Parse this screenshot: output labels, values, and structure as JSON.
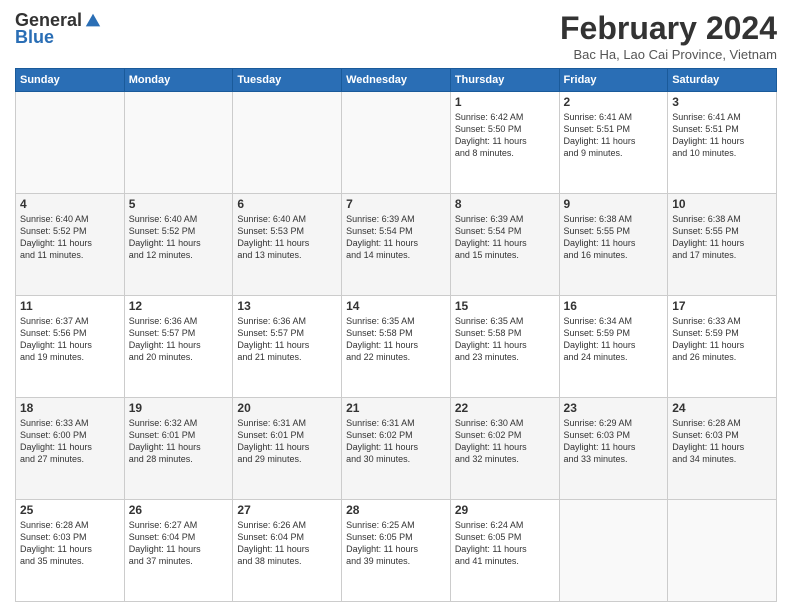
{
  "logo": {
    "general": "General",
    "blue": "Blue"
  },
  "header": {
    "month": "February 2024",
    "location": "Bac Ha, Lao Cai Province, Vietnam"
  },
  "days_of_week": [
    "Sunday",
    "Monday",
    "Tuesday",
    "Wednesday",
    "Thursday",
    "Friday",
    "Saturday"
  ],
  "weeks": [
    [
      {
        "day": "",
        "info": ""
      },
      {
        "day": "",
        "info": ""
      },
      {
        "day": "",
        "info": ""
      },
      {
        "day": "",
        "info": ""
      },
      {
        "day": "1",
        "info": "Sunrise: 6:42 AM\nSunset: 5:50 PM\nDaylight: 11 hours\nand 8 minutes."
      },
      {
        "day": "2",
        "info": "Sunrise: 6:41 AM\nSunset: 5:51 PM\nDaylight: 11 hours\nand 9 minutes."
      },
      {
        "day": "3",
        "info": "Sunrise: 6:41 AM\nSunset: 5:51 PM\nDaylight: 11 hours\nand 10 minutes."
      }
    ],
    [
      {
        "day": "4",
        "info": "Sunrise: 6:40 AM\nSunset: 5:52 PM\nDaylight: 11 hours\nand 11 minutes."
      },
      {
        "day": "5",
        "info": "Sunrise: 6:40 AM\nSunset: 5:52 PM\nDaylight: 11 hours\nand 12 minutes."
      },
      {
        "day": "6",
        "info": "Sunrise: 6:40 AM\nSunset: 5:53 PM\nDaylight: 11 hours\nand 13 minutes."
      },
      {
        "day": "7",
        "info": "Sunrise: 6:39 AM\nSunset: 5:54 PM\nDaylight: 11 hours\nand 14 minutes."
      },
      {
        "day": "8",
        "info": "Sunrise: 6:39 AM\nSunset: 5:54 PM\nDaylight: 11 hours\nand 15 minutes."
      },
      {
        "day": "9",
        "info": "Sunrise: 6:38 AM\nSunset: 5:55 PM\nDaylight: 11 hours\nand 16 minutes."
      },
      {
        "day": "10",
        "info": "Sunrise: 6:38 AM\nSunset: 5:55 PM\nDaylight: 11 hours\nand 17 minutes."
      }
    ],
    [
      {
        "day": "11",
        "info": "Sunrise: 6:37 AM\nSunset: 5:56 PM\nDaylight: 11 hours\nand 19 minutes."
      },
      {
        "day": "12",
        "info": "Sunrise: 6:36 AM\nSunset: 5:57 PM\nDaylight: 11 hours\nand 20 minutes."
      },
      {
        "day": "13",
        "info": "Sunrise: 6:36 AM\nSunset: 5:57 PM\nDaylight: 11 hours\nand 21 minutes."
      },
      {
        "day": "14",
        "info": "Sunrise: 6:35 AM\nSunset: 5:58 PM\nDaylight: 11 hours\nand 22 minutes."
      },
      {
        "day": "15",
        "info": "Sunrise: 6:35 AM\nSunset: 5:58 PM\nDaylight: 11 hours\nand 23 minutes."
      },
      {
        "day": "16",
        "info": "Sunrise: 6:34 AM\nSunset: 5:59 PM\nDaylight: 11 hours\nand 24 minutes."
      },
      {
        "day": "17",
        "info": "Sunrise: 6:33 AM\nSunset: 5:59 PM\nDaylight: 11 hours\nand 26 minutes."
      }
    ],
    [
      {
        "day": "18",
        "info": "Sunrise: 6:33 AM\nSunset: 6:00 PM\nDaylight: 11 hours\nand 27 minutes."
      },
      {
        "day": "19",
        "info": "Sunrise: 6:32 AM\nSunset: 6:01 PM\nDaylight: 11 hours\nand 28 minutes."
      },
      {
        "day": "20",
        "info": "Sunrise: 6:31 AM\nSunset: 6:01 PM\nDaylight: 11 hours\nand 29 minutes."
      },
      {
        "day": "21",
        "info": "Sunrise: 6:31 AM\nSunset: 6:02 PM\nDaylight: 11 hours\nand 30 minutes."
      },
      {
        "day": "22",
        "info": "Sunrise: 6:30 AM\nSunset: 6:02 PM\nDaylight: 11 hours\nand 32 minutes."
      },
      {
        "day": "23",
        "info": "Sunrise: 6:29 AM\nSunset: 6:03 PM\nDaylight: 11 hours\nand 33 minutes."
      },
      {
        "day": "24",
        "info": "Sunrise: 6:28 AM\nSunset: 6:03 PM\nDaylight: 11 hours\nand 34 minutes."
      }
    ],
    [
      {
        "day": "25",
        "info": "Sunrise: 6:28 AM\nSunset: 6:03 PM\nDaylight: 11 hours\nand 35 minutes."
      },
      {
        "day": "26",
        "info": "Sunrise: 6:27 AM\nSunset: 6:04 PM\nDaylight: 11 hours\nand 37 minutes."
      },
      {
        "day": "27",
        "info": "Sunrise: 6:26 AM\nSunset: 6:04 PM\nDaylight: 11 hours\nand 38 minutes."
      },
      {
        "day": "28",
        "info": "Sunrise: 6:25 AM\nSunset: 6:05 PM\nDaylight: 11 hours\nand 39 minutes."
      },
      {
        "day": "29",
        "info": "Sunrise: 6:24 AM\nSunset: 6:05 PM\nDaylight: 11 hours\nand 41 minutes."
      },
      {
        "day": "",
        "info": ""
      },
      {
        "day": "",
        "info": ""
      }
    ]
  ]
}
